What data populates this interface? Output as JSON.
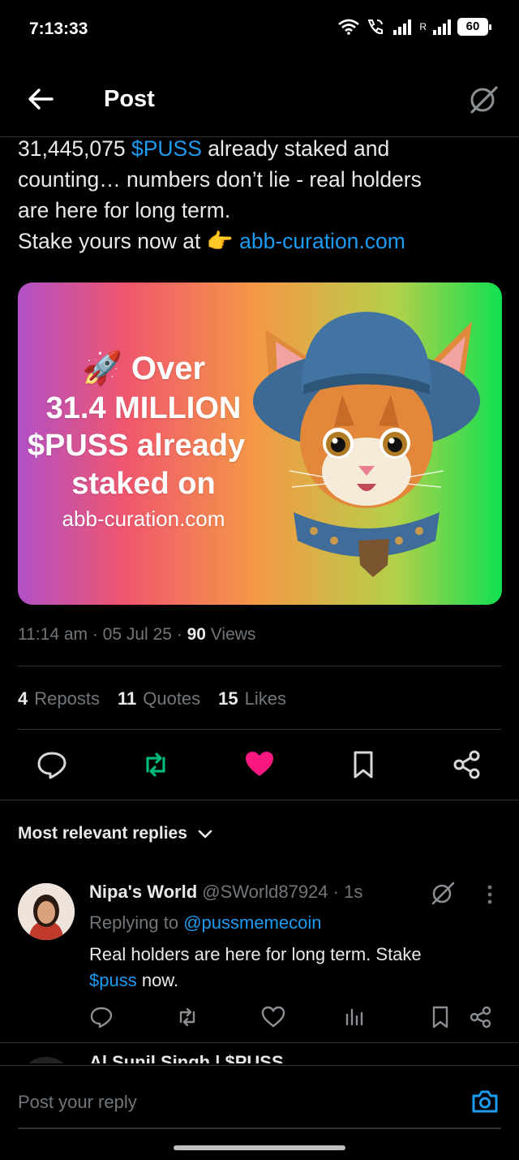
{
  "status_bar": {
    "time": "7:13:33",
    "battery": "60"
  },
  "header": {
    "title": "Post"
  },
  "post": {
    "line1_a": "31,445,075 ",
    "line1_link": "$PUSS",
    "line1_b": " already staked and",
    "line2": "counting… numbers don’t lie - real holders",
    "line3": "are here for long term.",
    "line4_a": "Stake yours now at ",
    "line4_emoji": "👉",
    "line4_link": "abb-curation.com",
    "image": {
      "rocket": "🚀",
      "line1": "Over",
      "line2": "31.4 MILLION",
      "line3": "$PUSS already",
      "line4": "staked on",
      "line5": "abb-curation.com"
    },
    "time": "11:14 am",
    "date": "05 Jul 25",
    "views_count": "90",
    "views_label": "Views",
    "reposts_count": "4",
    "reposts_label": "Reposts",
    "quotes_count": "11",
    "quotes_label": "Quotes",
    "likes_count": "15",
    "likes_label": "Likes"
  },
  "replies": {
    "header": "Most relevant replies",
    "items": [
      {
        "name": "Nipa's World",
        "handle": "@SWorld87924",
        "time": "1s",
        "replying_label": "Replying to ",
        "replying_handle": "@pussmemecoin",
        "text_a": "Real holders are here for long term. Stake",
        "text_link": "$puss",
        "text_b": " now."
      }
    ],
    "peek_name": "Al Sunil Singh | $PUSS"
  },
  "compose": {
    "placeholder": "Post your reply"
  },
  "colors": {
    "accent": "#1d9bf0",
    "repost_active": "#00ba7c",
    "like_active": "#f91880"
  }
}
